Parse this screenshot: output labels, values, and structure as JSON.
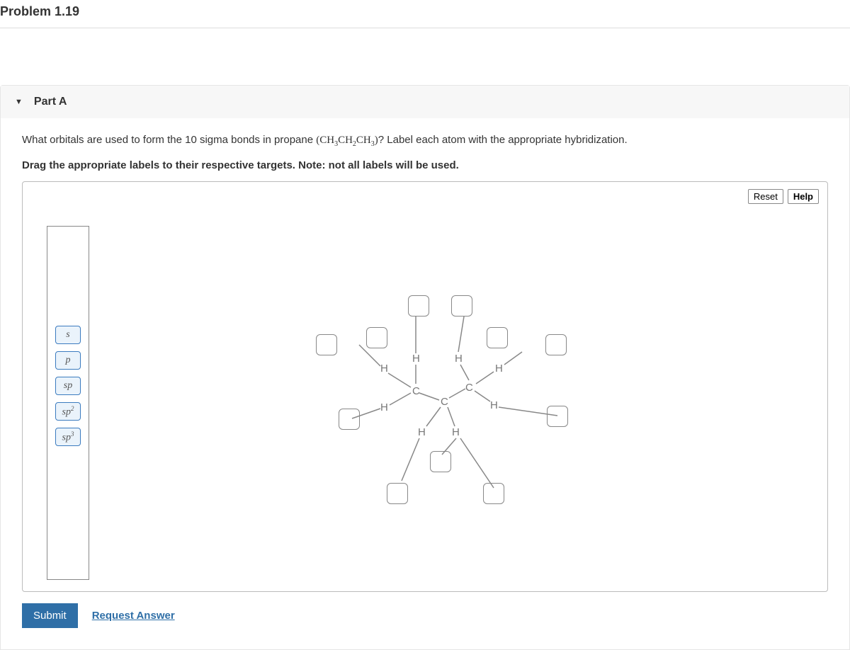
{
  "problem_title": "Problem 1.19",
  "part": {
    "label": "Part A",
    "question_prefix": "What orbitals are used to form the 10 sigma bonds in propane ",
    "formula_html": "(CH<sub>3</sub>CH<sub>2</sub>CH<sub>3</sub>)",
    "question_suffix": "? Label each atom with the appropriate hybridization.",
    "instruction": "Drag the appropriate labels to their respective targets. Note: not all labels will be used."
  },
  "buttons": {
    "reset": "Reset",
    "help": "Help",
    "submit": "Submit",
    "request": "Request Answer"
  },
  "labels": [
    "s",
    "p",
    "sp",
    "sp2",
    "sp3"
  ],
  "atoms": {
    "H": "H",
    "C": "C"
  }
}
